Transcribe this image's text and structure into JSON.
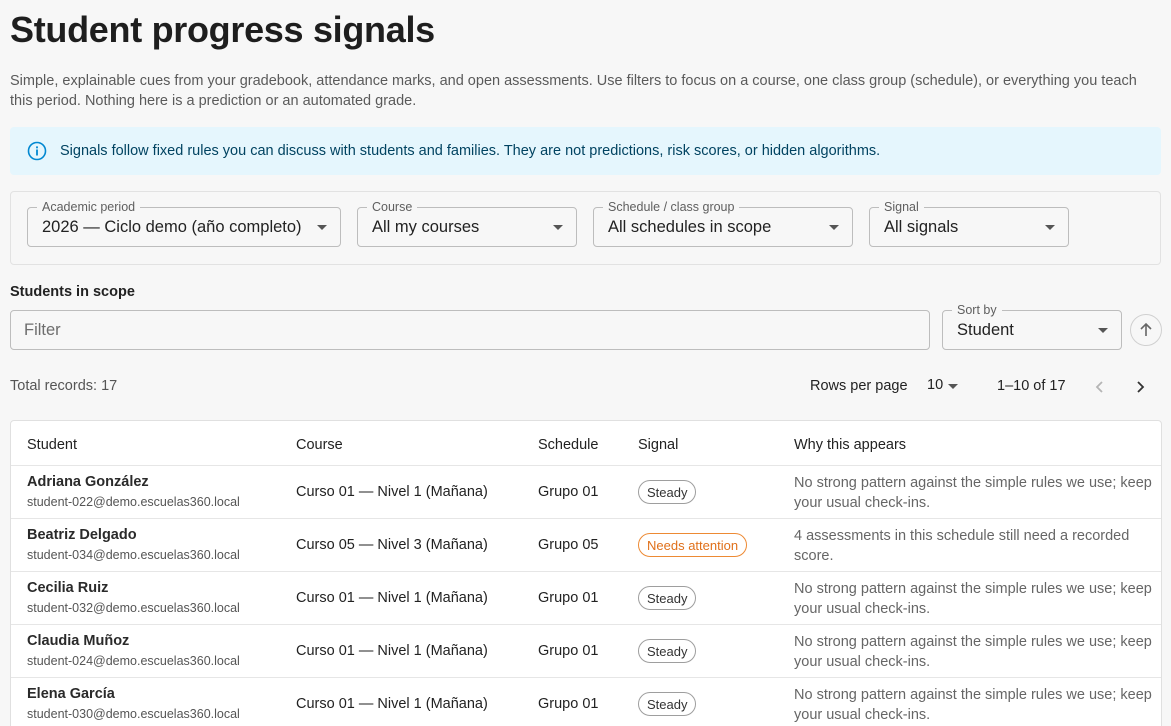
{
  "page": {
    "title": "Student progress signals",
    "subtitle": "Simple, explainable cues from your gradebook, attendance marks, and open assessments. Use filters to focus on a course, one class group (schedule), or everything you teach this period. Nothing here is a prediction or an automated grade."
  },
  "banner": {
    "icon": "info-icon",
    "text": "Signals follow fixed rules you can discuss with students and families. They are not predictions, risk scores, or hidden algorithms."
  },
  "filters": {
    "period": {
      "label": "Academic period",
      "value": "2026 — Ciclo demo (año completo)"
    },
    "course": {
      "label": "Course",
      "value": "All my courses"
    },
    "schedule": {
      "label": "Schedule / class group",
      "value": "All schedules in scope"
    },
    "signal": {
      "label": "Signal",
      "value": "All signals"
    }
  },
  "scope": {
    "title": "Students in scope",
    "filter_placeholder": "Filter",
    "sort_label": "Sort by",
    "sort_value": "Student",
    "sort_icon": "arrow-up-icon"
  },
  "pager": {
    "total": "Total records: 17",
    "rows_per_page_label": "Rows per page",
    "rows_per_page": "10",
    "range": "1–10 of 17"
  },
  "table": {
    "columns": [
      "Student",
      "Course",
      "Schedule",
      "Signal",
      "Why this appears"
    ],
    "rows": [
      {
        "name": "Adriana González",
        "email": "student-022@demo.escuelas360.local",
        "course": "Curso 01 — Nivel 1 (Mañana)",
        "schedule": "Grupo 01",
        "signal": "Steady",
        "why": "No strong pattern against the simple rules we use; keep your usual check-ins."
      },
      {
        "name": "Beatriz Delgado",
        "email": "student-034@demo.escuelas360.local",
        "course": "Curso 05 — Nivel 3 (Mañana)",
        "schedule": "Grupo 05",
        "signal": "Needs attention",
        "why": "4 assessments in this schedule still need a recorded score."
      },
      {
        "name": "Cecilia Ruiz",
        "email": "student-032@demo.escuelas360.local",
        "course": "Curso 01 — Nivel 1 (Mañana)",
        "schedule": "Grupo 01",
        "signal": "Steady",
        "why": "No strong pattern against the simple rules we use; keep your usual check-ins."
      },
      {
        "name": "Claudia Muñoz",
        "email": "student-024@demo.escuelas360.local",
        "course": "Curso 01 — Nivel 1 (Mañana)",
        "schedule": "Grupo 01",
        "signal": "Steady",
        "why": "No strong pattern against the simple rules we use; keep your usual check-ins."
      },
      {
        "name": "Elena García",
        "email": "student-030@demo.escuelas360.local",
        "course": "Curso 01 — Nivel 1 (Mañana)",
        "schedule": "Grupo 01",
        "signal": "Steady",
        "why": "No strong pattern against the simple rules we use; keep your usual check-ins."
      }
    ]
  },
  "colors": {
    "banner_bg": "#e5f6fd",
    "banner_text": "#014361",
    "warning": "#ed8a34"
  }
}
